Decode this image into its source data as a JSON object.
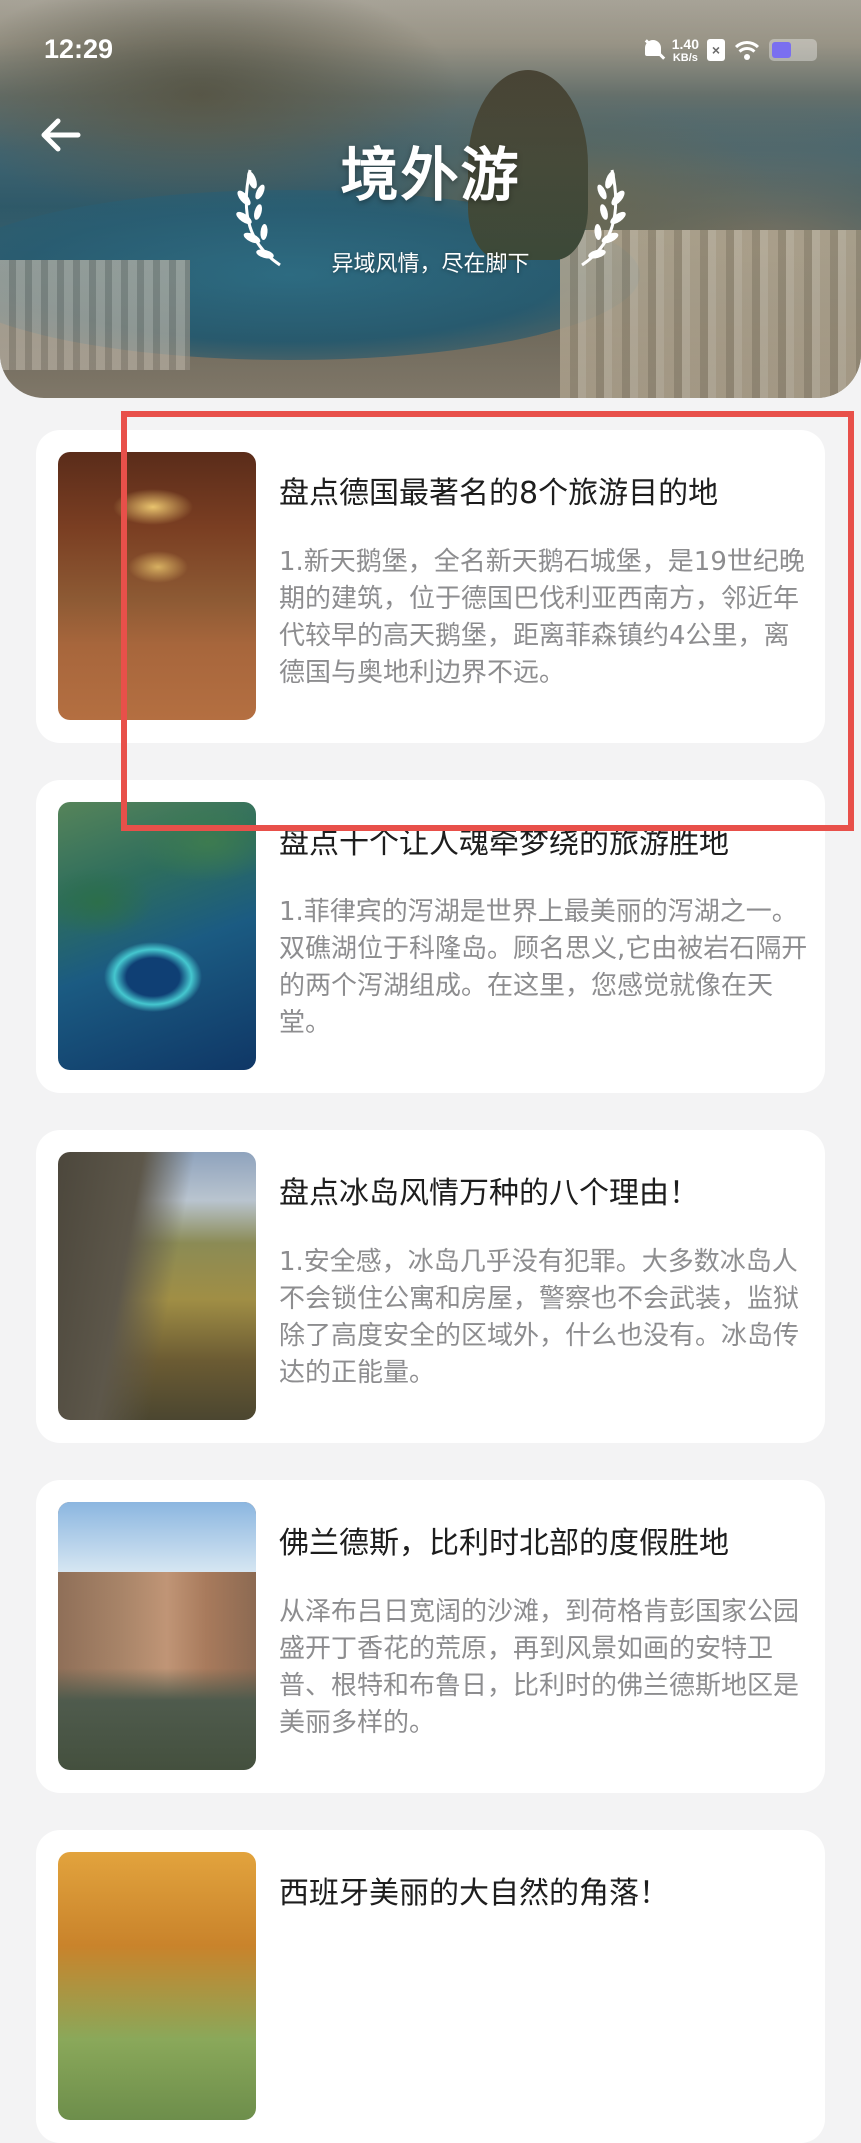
{
  "status_bar": {
    "time": "12:29",
    "net_speed_value": "1.40",
    "net_speed_unit": "KB/s",
    "sim_badge": "×",
    "battery_level": 0.45
  },
  "header": {
    "title": "境外游",
    "subtitle": "异域风情，尽在脚下"
  },
  "articles": [
    {
      "title": "盘点德国最著名的8个旅游目的地",
      "excerpt": "1.新天鹅堡，全名新天鹅石城堡，是19世纪晚期的建筑，位于德国巴伐利亚西南方，邻近年代较早的高天鹅堡，距离菲森镇约4公里，离德国与奥地利边界不远。",
      "image": "palace-hall-photo"
    },
    {
      "title": "盘点十个让人魂牵梦绕的旅游胜地",
      "excerpt": "1.菲律宾的泻湖是世界上最美丽的泻湖之一。双礁湖位于科隆岛。顾名思义,它由被岩石隔开的两个泻湖组成。在这里，您感觉就像在天堂。",
      "image": "lagoon-aerial-photo"
    },
    {
      "title": "盘点冰岛风情万种的八个理由！",
      "excerpt": "1.安全感，冰岛几乎没有犯罪。大多数冰岛人不会锁住公寓和房屋，警察也不会武装，监狱除了高度安全的区域外，什么也没有。冰岛传达的正能量。",
      "image": "iceland-valley-photo"
    },
    {
      "title": "佛兰德斯，比利时北部的度假胜地",
      "excerpt": "从泽布吕日宽阔的沙滩，到荷格肯彭国家公园盛开丁香花的荒原，再到风景如画的安特卫普、根特和布鲁日，比利时的佛兰德斯地区是美丽多样的。",
      "image": "bruges-canal-photo"
    },
    {
      "title": "西班牙美丽的大自然的角落！",
      "excerpt": "",
      "image": "spain-forest-photo"
    }
  ],
  "colors": {
    "page_background": "#f3f3f4",
    "card_background": "#ffffff",
    "title_text": "#1d1d1d",
    "excerpt_text": "#8d8d8f",
    "highlight_border": "#e8504a",
    "battery_fill": "#7a6ff0"
  }
}
